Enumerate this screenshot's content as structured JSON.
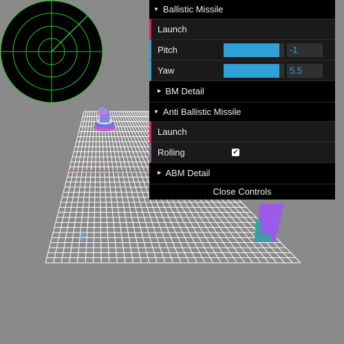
{
  "controls": {
    "ballistic": {
      "title": "Ballistic Missile",
      "launch_label": "Launch",
      "pitch_label": "Pitch",
      "pitch_value": "-1",
      "pitch_fill_fraction": 0.92,
      "yaw_label": "Yaw",
      "yaw_value": "5.5",
      "yaw_fill_fraction": 0.92,
      "detail_label": "BM Detail"
    },
    "anti_ballistic": {
      "title": "Anti Ballistic Missile",
      "launch_label": "Launch",
      "rolling_label": "Rolling",
      "rolling_checked": true,
      "detail_label": "ABM Detail"
    },
    "close_label": "Close Controls"
  },
  "colors": {
    "background": "#8a8a8a",
    "radar_green": "#1fd11f",
    "grid": "#ffffff",
    "red_line": "#cc2222",
    "slider_blue": "#2fa1d6",
    "function_accent": "#e61d5f"
  },
  "icons": {
    "folder_open": "triangle-down-icon",
    "folder_closed": "triangle-right-icon",
    "checkmark": "check-icon"
  }
}
